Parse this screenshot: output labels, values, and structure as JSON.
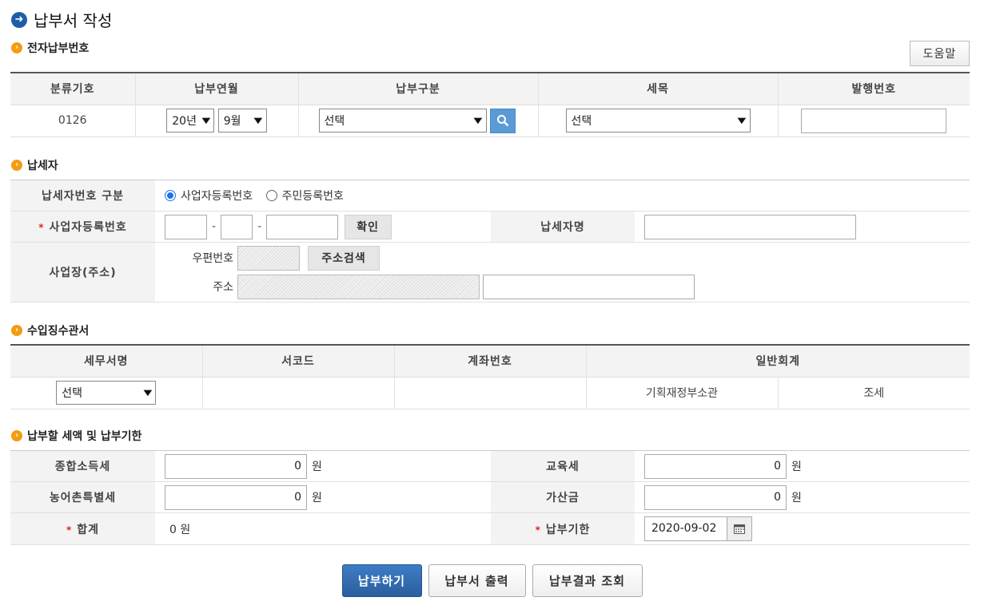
{
  "page": {
    "title": "납부서 작성",
    "help_label": "도움말"
  },
  "sections": {
    "payment_number": "전자납부번호",
    "taxpayer": "납세자",
    "collector": "수입징수관서",
    "amount": "납부할 세액 및 납부기한"
  },
  "payment_number": {
    "headers": [
      "분류기호",
      "납부연월",
      "납부구분",
      "세목",
      "발행번호"
    ],
    "code": "0126",
    "year": "20년",
    "month": "9월",
    "payment_type": "선택",
    "tax_item": "선택",
    "issue_number": ""
  },
  "taxpayer": {
    "id_type_label": "납세자번호 구분",
    "option_business": "사업자등록번호",
    "option_resident": "주민등록번호",
    "business_no_label": "사업자등록번호",
    "confirm_label": "확인",
    "name_label": "납세자명",
    "address_label": "사업장(주소)",
    "postal_label": "우편번호",
    "address_search_label": "주소검색",
    "addr_label": "주소",
    "required_mark": "*"
  },
  "collector": {
    "headers": [
      "세무서명",
      "서코드",
      "계좌번호",
      "일반회계"
    ],
    "office_select": "선택",
    "office_code": "",
    "account": "",
    "general_account": "기획재정부소관",
    "general_type": "조세"
  },
  "amount": {
    "income_tax_label": "종합소득세",
    "income_tax": "0",
    "education_tax_label": "교육세",
    "education_tax": "0",
    "rural_tax_label": "농어촌특별세",
    "rural_tax": "0",
    "penalty_label": "가산금",
    "penalty": "0",
    "unit": "원",
    "total_label": "합계",
    "total": "0 원",
    "deadline_label": "납부기한",
    "deadline": "2020-09-02"
  },
  "buttons": {
    "pay": "납부하기",
    "print": "납부서 출력",
    "result": "납부결과 조회"
  },
  "colors": {
    "primary": "#2a5f9e",
    "accent_orange": "#f39c12",
    "required": "#d9241c",
    "search_blue": "#5b9bd5"
  }
}
